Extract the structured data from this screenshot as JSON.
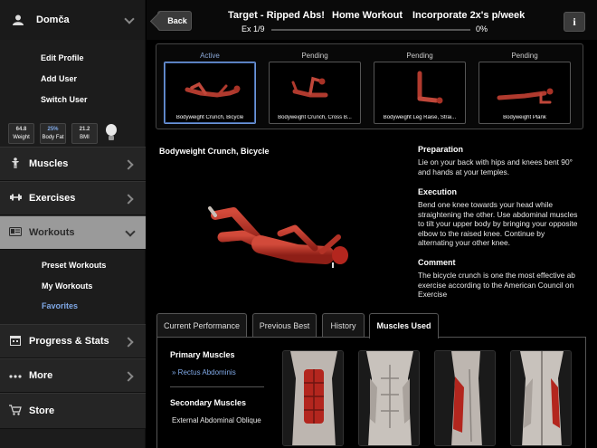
{
  "sidebar": {
    "profile_name": "Domča",
    "profile_menu": [
      "Edit Profile",
      "Add User",
      "Switch User"
    ],
    "stats": [
      {
        "value": "64.8",
        "label": "Weight",
        "color": "#dddddd"
      },
      {
        "value": "25%",
        "label": "Body Fat",
        "color": "#7fa8e6"
      },
      {
        "value": "21.2",
        "label": "BMI",
        "color": "#dddddd"
      }
    ],
    "nav": {
      "muscles": "Muscles",
      "exercises": "Exercises",
      "workouts": "Workouts",
      "progress": "Progress & Stats",
      "more": "More",
      "store": "Store"
    },
    "workouts_sub": [
      "Preset Workouts",
      "My Workouts",
      "Favorites"
    ]
  },
  "header": {
    "back_label": "Back",
    "workout_name": "Target - Ripped Abs!",
    "workout_type": "Home Workout",
    "frequency": "Incorporate 2x's p/week",
    "exercise_counter": "Ex 1/9",
    "progress_percent": "0%",
    "progress_value": 0,
    "info_label": "i"
  },
  "exercises": [
    {
      "status": "Active",
      "name": "Bodyweight Crunch, Bicycle"
    },
    {
      "status": "Pending",
      "name": "Bodyweight Crunch, Cross B..."
    },
    {
      "status": "Pending",
      "name": "Bodyweight Leg Raise, Strai..."
    },
    {
      "status": "Pending",
      "name": "Bodyweight Plank"
    }
  ],
  "current": {
    "title": "Bodyweight Crunch, Bicycle",
    "preparation_heading": "Preparation",
    "preparation": "Lie on your back with hips and knees bent 90° and hands at your temples.",
    "execution_heading": "Execution",
    "execution": "Bend one knee towards your head while straightening the other. Use abdominal muscles to tilt your upper body by bringing your opposite elbow to the raised knee. Continue by alternating your other knee.",
    "comment_heading": "Comment",
    "comment": "The bicycle crunch is one the most effective ab exercise according to the American Council on Exercise"
  },
  "tabs": [
    "Current Performance",
    "Previous Best",
    "History",
    "Muscles Used"
  ],
  "muscles": {
    "primary_heading": "Primary Muscles",
    "primary": "» Rectus Abdominis",
    "secondary_heading": "Secondary Muscles",
    "secondary": "External Abdominal Oblique"
  },
  "colors": {
    "accent_blue": "#7fa8e6",
    "sidebar_bg": "#1c1c1c",
    "active_nav": "#9a9a9a",
    "muscle_red": "#b3261e"
  }
}
